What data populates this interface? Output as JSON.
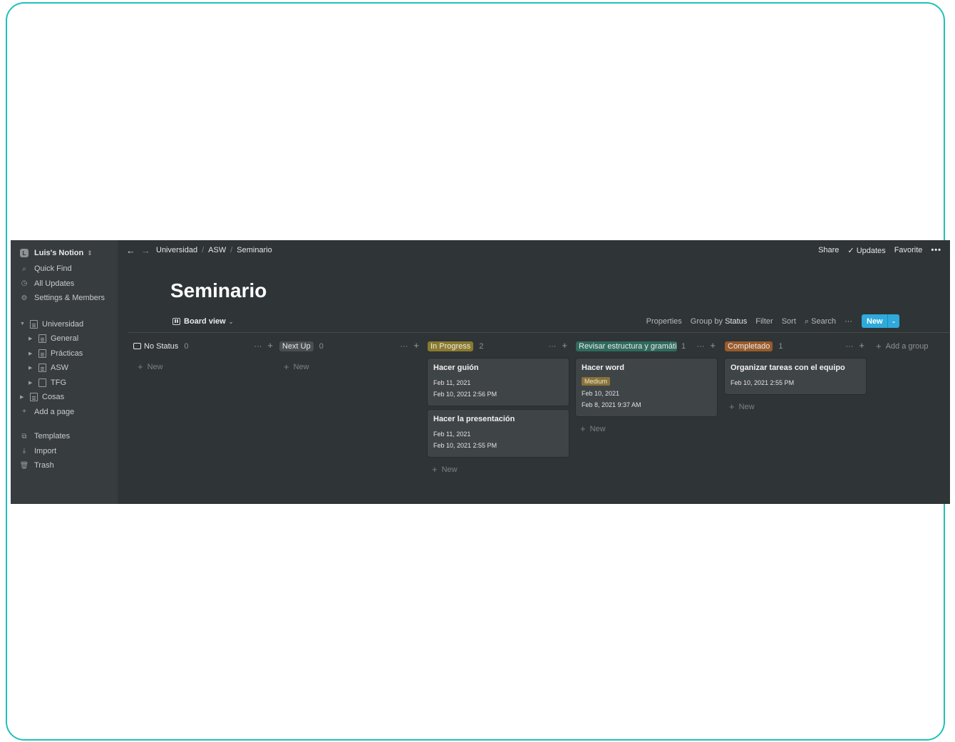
{
  "sidebar": {
    "workspace": "Luis's Notion",
    "workspace_initial": "L",
    "top_items": [
      "Quick Find",
      "All Updates",
      "Settings & Members"
    ],
    "pages": {
      "universidad": "Universidad",
      "children": [
        "General",
        "Prácticas",
        "ASW",
        "TFG"
      ],
      "cosas": "Cosas",
      "add_page": "Add a page"
    },
    "bottom_items": [
      "Templates",
      "Import",
      "Trash"
    ]
  },
  "topbar": {
    "breadcrumb": [
      "Universidad",
      "ASW",
      "Seminario"
    ],
    "share": "Share",
    "updates": "Updates",
    "favorite": "Favorite",
    "more": "•••"
  },
  "page": {
    "title": "Seminario",
    "view": "Board view"
  },
  "toolbar": {
    "properties": "Properties",
    "group_by_prefix": "Group by",
    "group_by_value": "Status",
    "filter": "Filter",
    "sort": "Sort",
    "search": "Search",
    "more": "···",
    "new": "New"
  },
  "board": {
    "new_label": "New",
    "add_group": "Add a group",
    "columns": [
      {
        "name": "No Status",
        "count": "0",
        "color": null,
        "cards": []
      },
      {
        "name": "Next Up",
        "count": "0",
        "color": "#4a4f52",
        "cards": []
      },
      {
        "name": "In Progress",
        "count": "2",
        "color": "#8a7a2c",
        "cards": [
          {
            "title": "Hacer guión",
            "date1": "Feb 11, 2021",
            "date2": "Feb 10, 2021 2:56 PM"
          },
          {
            "title": "Hacer la presentación",
            "date1": "Feb 11, 2021",
            "date2": "Feb 10, 2021 2:55 PM"
          }
        ]
      },
      {
        "name": "Revisar estructura y gramática",
        "count": "1",
        "color": "#2f6b5c",
        "cards": [
          {
            "title": "Hacer word",
            "tag": "Medium",
            "date1": "Feb 10, 2021",
            "date2": "Feb 8, 2021 9:37 AM"
          }
        ]
      },
      {
        "name": "Completado",
        "count": "1",
        "color": "#9a5b2a",
        "cards": [
          {
            "title": "Organizar tareas con el equipo",
            "date1": "Feb 10, 2021 2:55 PM"
          }
        ]
      }
    ]
  }
}
